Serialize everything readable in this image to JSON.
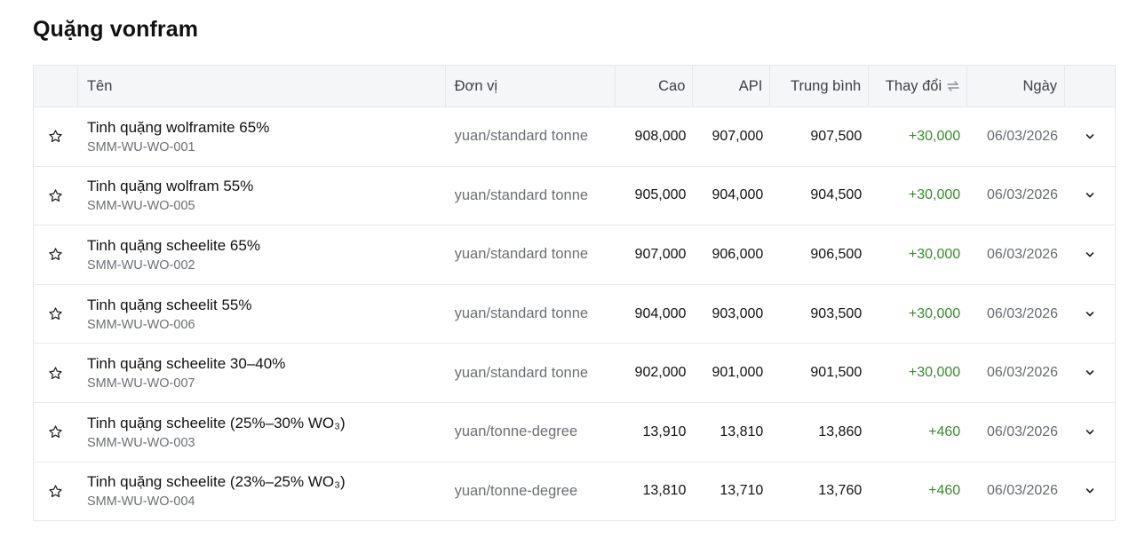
{
  "page": {
    "title": "Quặng vonfram"
  },
  "table": {
    "headers": {
      "name": "Tên",
      "unit": "Đơn vị",
      "high": "Cao",
      "api": "API",
      "avg": "Trung bình",
      "change": "Thay đổi",
      "date": "Ngày"
    },
    "rows": [
      {
        "name": "Tinh quặng wolframite 65%",
        "code": "SMM-WU-WO-001",
        "unit": "yuan/standard tonne",
        "high": "908,000",
        "api": "907,000",
        "avg": "907,500",
        "change": "+30,000",
        "date": "06/03/2026"
      },
      {
        "name": "Tinh quặng wolfram 55%",
        "code": "SMM-WU-WO-005",
        "unit": "yuan/standard tonne",
        "high": "905,000",
        "api": "904,000",
        "avg": "904,500",
        "change": "+30,000",
        "date": "06/03/2026"
      },
      {
        "name": "Tinh quặng scheelite 65%",
        "code": "SMM-WU-WO-002",
        "unit": "yuan/standard tonne",
        "high": "907,000",
        "api": "906,000",
        "avg": "906,500",
        "change": "+30,000",
        "date": "06/03/2026"
      },
      {
        "name": "Tinh quặng scheelit 55%",
        "code": "SMM-WU-WO-006",
        "unit": "yuan/standard tonne",
        "high": "904,000",
        "api": "903,000",
        "avg": "903,500",
        "change": "+30,000",
        "date": "06/03/2026"
      },
      {
        "name": "Tinh quặng scheelite 30–40%",
        "code": "SMM-WU-WO-007",
        "unit": "yuan/standard tonne",
        "high": "902,000",
        "api": "901,000",
        "avg": "901,500",
        "change": "+30,000",
        "date": "06/03/2026"
      },
      {
        "name": "Tinh quặng scheelite (25%–30% WO₃)",
        "code": "SMM-WU-WO-003",
        "unit": "yuan/tonne-degree",
        "high": "13,910",
        "api": "13,810",
        "avg": "13,860",
        "change": "+460",
        "date": "06/03/2026"
      },
      {
        "name": "Tinh quặng scheelite (23%–25% WO₃)",
        "code": "SMM-WU-WO-004",
        "unit": "yuan/tonne-degree",
        "high": "13,810",
        "api": "13,710",
        "avg": "13,760",
        "change": "+460",
        "date": "06/03/2026"
      }
    ]
  },
  "icons": {
    "favorite": "star-icon",
    "expand": "chevron-down-icon",
    "sort": "swap-arrows-icon"
  },
  "colors": {
    "positive_change": "#3a8a2e",
    "header_bg": "#f5f6f8",
    "border": "#e6e8eb"
  }
}
